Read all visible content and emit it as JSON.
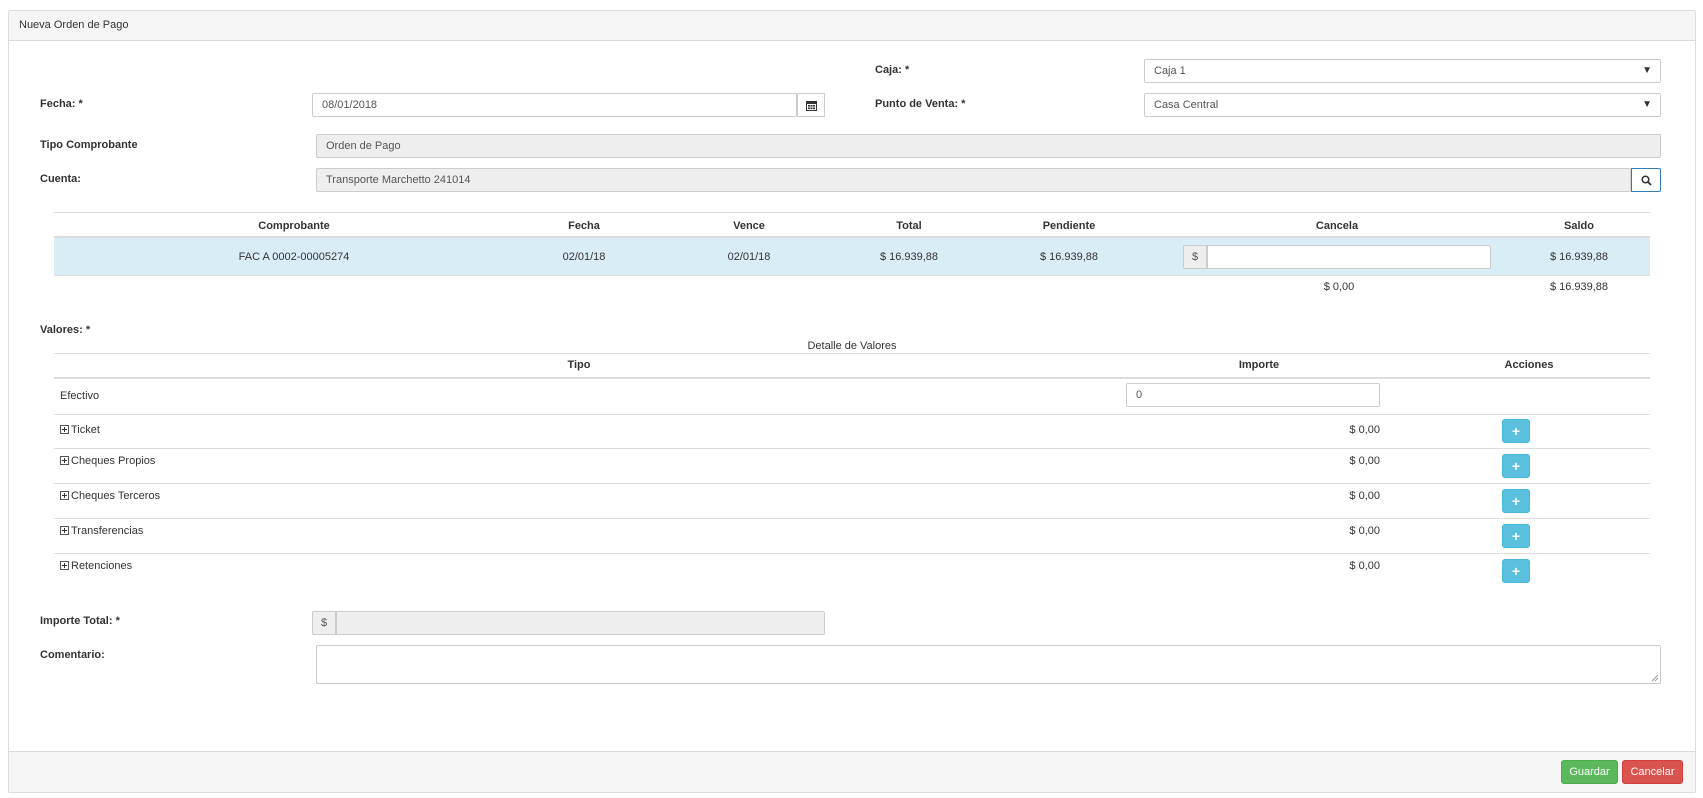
{
  "panel": {
    "title": "Nueva Orden de Pago"
  },
  "form": {
    "caja": {
      "label": "Caja: *",
      "value": "Caja 1"
    },
    "fecha": {
      "label": "Fecha: *",
      "value": "08/01/2018"
    },
    "punto_venta": {
      "label": "Punto de Venta: *",
      "value": "Casa Central"
    },
    "tipo_comprobante": {
      "label": "Tipo Comprobante",
      "value": "Orden de Pago"
    },
    "cuenta": {
      "label": "Cuenta:",
      "value": "Transporte Marchetto 241014"
    }
  },
  "comprobantes": {
    "headers": [
      "Comprobante",
      "Fecha",
      "Vence",
      "Total",
      "Pendiente",
      "Cancela",
      "Saldo"
    ],
    "rows": [
      {
        "comprobante": "FAC A 0002-00005274",
        "fecha": "02/01/18",
        "vence": "02/01/18",
        "total": "$ 16.939,88",
        "pendiente": "$ 16.939,88",
        "cancela_prefix": "$",
        "cancela_value": "",
        "saldo": "$ 16.939,88"
      }
    ],
    "totals": {
      "cancela": "$ 0,00",
      "saldo": "$ 16.939,88"
    }
  },
  "valores": {
    "label": "Valores: *",
    "caption": "Detalle de Valores",
    "headers": {
      "tipo": "Tipo",
      "importe": "Importe",
      "acciones": "Acciones"
    },
    "efectivo": {
      "label": "Efectivo",
      "value": "0"
    },
    "groups": [
      {
        "label": "Ticket",
        "importe": "$ 0,00",
        "action": "+"
      },
      {
        "label": "Cheques Propios",
        "importe": "$ 0,00",
        "action": "+"
      },
      {
        "label": "Cheques Terceros",
        "importe": "$ 0,00",
        "action": "+"
      },
      {
        "label": "Transferencias",
        "importe": "$ 0,00",
        "action": "+"
      },
      {
        "label": "Retenciones",
        "importe": "$ 0,00",
        "action": "+"
      }
    ]
  },
  "importe_total": {
    "label": "Importe Total: *",
    "prefix": "$",
    "value": ""
  },
  "comentario": {
    "label": "Comentario:",
    "value": ""
  },
  "footer": {
    "save_label": "Guardar",
    "cancel_label": "Cancelar"
  },
  "colors": {
    "info": "#5bc0de",
    "success": "#5cb85c",
    "danger": "#d9534f",
    "row_highlight": "#d9edf7"
  }
}
